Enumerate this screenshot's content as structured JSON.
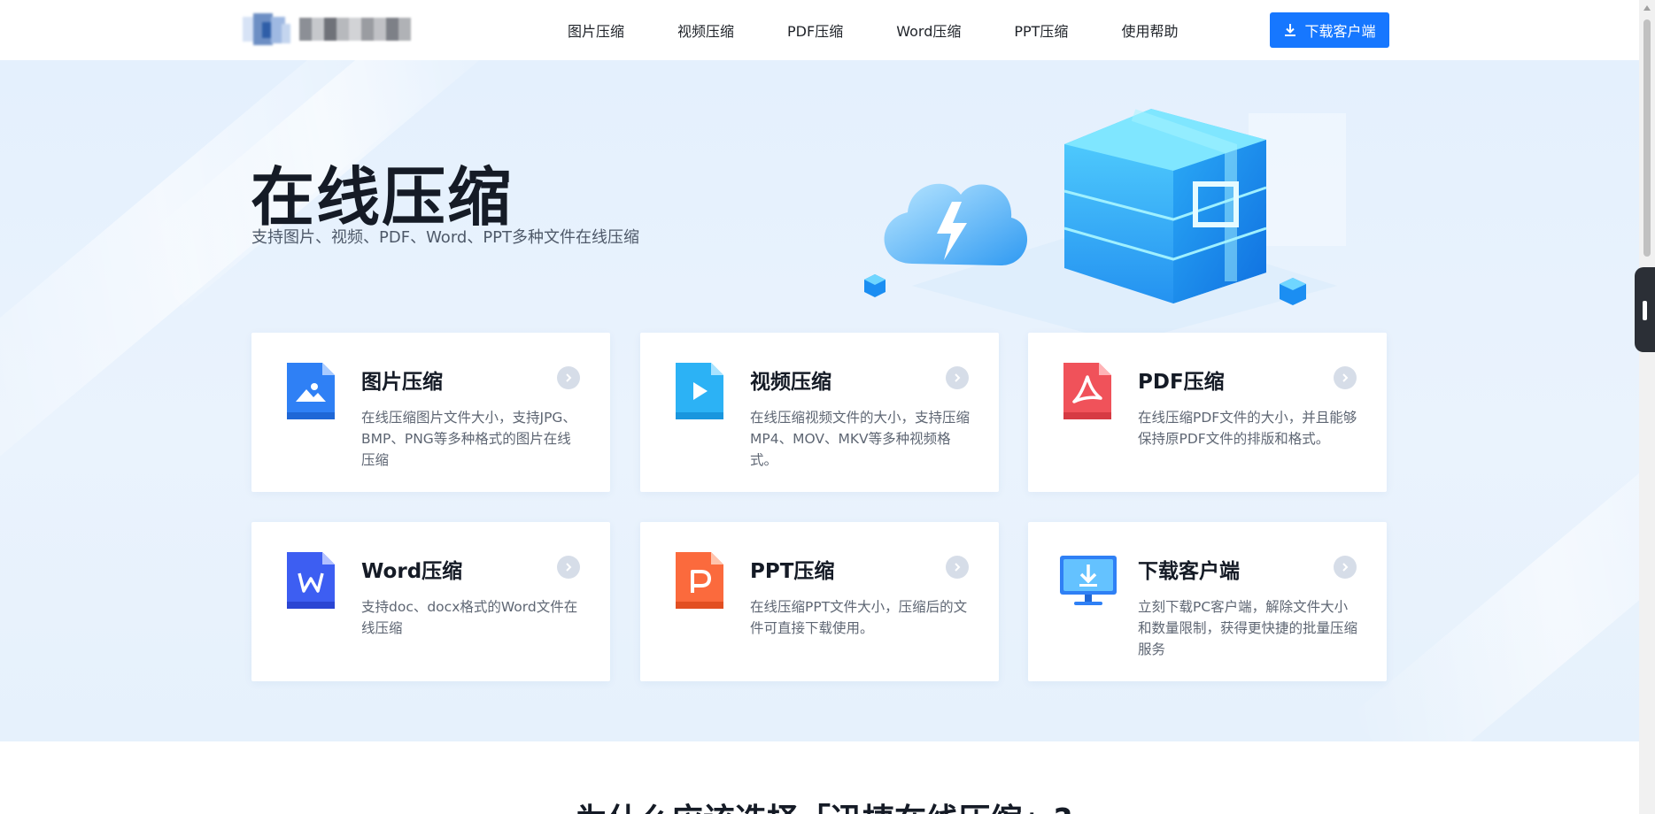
{
  "header": {
    "nav": [
      {
        "label": "图片压缩"
      },
      {
        "label": "视频压缩"
      },
      {
        "label": "PDF压缩"
      },
      {
        "label": "Word压缩"
      },
      {
        "label": "PPT压缩"
      },
      {
        "label": "使用帮助"
      }
    ],
    "download_label": "下载客户端"
  },
  "hero": {
    "title": "在线压缩",
    "subtitle": "支持图片、视频、PDF、Word、PPT多种文件在线压缩"
  },
  "cards": [
    {
      "title": "图片压缩",
      "desc": "在线压缩图片文件大小，支持JPG、BMP、PNG等多种格式的图片在线压缩",
      "icon": "image-file-icon"
    },
    {
      "title": "视频压缩",
      "desc": "在线压缩视频文件的大小，支持压缩MP4、MOV、MKV等多种视频格式。",
      "icon": "video-file-icon"
    },
    {
      "title": "PDF压缩",
      "desc": "在线压缩PDF文件的大小，并且能够保持原PDF文件的排版和格式。",
      "icon": "pdf-file-icon"
    },
    {
      "title": "Word压缩",
      "desc": "支持doc、docx格式的Word文件在线压缩",
      "icon": "word-file-icon"
    },
    {
      "title": "PPT压缩",
      "desc": "在线压缩PPT文件大小，压缩后的文件可直接下载使用。",
      "icon": "ppt-file-icon"
    },
    {
      "title": "下载客户端",
      "desc": "立刻下载PC客户端，解除文件大小和数量限制，获得更快捷的批量压缩服务",
      "icon": "monitor-download-icon"
    }
  ],
  "section2": {
    "heading": "为什么应该选择「迅捷在线压缩」?"
  },
  "colors": {
    "accent": "#1677ff",
    "image": "#2f80f5",
    "video": "#2cb2f5",
    "pdf": "#f0525a",
    "word": "#3d5ef2",
    "ppt": "#fb6a3d"
  }
}
